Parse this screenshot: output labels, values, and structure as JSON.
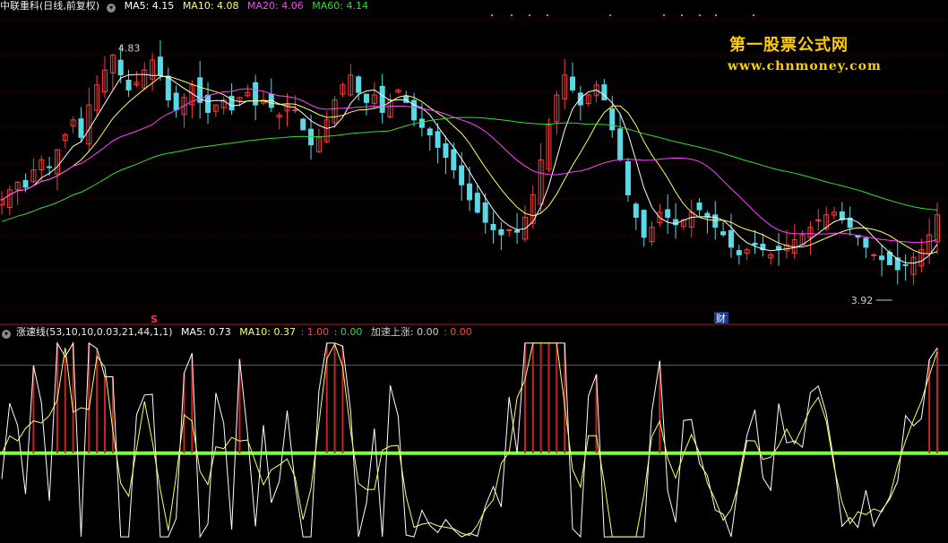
{
  "main_header": {
    "title": "中联重科(日线,前复权)",
    "ma5": "MA5: 4.15",
    "ma10": "MA10: 4.08",
    "ma20": "MA20: 4.06",
    "ma60": "MA60: 4.14"
  },
  "sub_header": {
    "title": "涨速线(53,10,10,0.03,21,44,1,1)",
    "ma5": "MA5: 0.73",
    "ma10": "MA10: 0.37",
    "v1": ": 1.00",
    "v2": ": 0.00",
    "accel_label": "加速上涨: 0.00",
    "v3": ": 0.00"
  },
  "watermark": {
    "line1": "第一股票公式网",
    "line2": "www.chnmoney.com"
  },
  "markers": {
    "s_label": "S",
    "fin_label": "财"
  },
  "colors": {
    "up": "#ff3b3b",
    "down": "#5ad8e6",
    "ma5": "#ffffff",
    "ma10": "#ffff66",
    "ma20": "#ff44ff",
    "ma60": "#33dd33",
    "green_band": "#7cff3c",
    "red_line": "#e02020"
  },
  "chart_data": [
    {
      "type": "candlestick",
      "title": "中联重科(日线,前复权)",
      "annotations": [
        {
          "label": "4.83",
          "type": "high"
        },
        {
          "label": "3.92",
          "type": "low"
        }
      ],
      "series": [
        {
          "name": "MA5",
          "value": 4.15
        },
        {
          "name": "MA10",
          "value": 4.08
        },
        {
          "name": "MA20",
          "value": 4.06
        },
        {
          "name": "MA60",
          "value": 4.14
        }
      ],
      "close": [
        4.2,
        4.24,
        4.27,
        4.25,
        4.32,
        4.36,
        4.33,
        4.4,
        4.46,
        4.52,
        4.45,
        4.58,
        4.66,
        4.72,
        4.78,
        4.7,
        4.64,
        4.67,
        4.72,
        4.76,
        4.7,
        4.6,
        4.56,
        4.61,
        4.66,
        4.59,
        4.55,
        4.58,
        4.6,
        4.56,
        4.61,
        4.63,
        4.58,
        4.6,
        4.57,
        4.54,
        4.58,
        4.56,
        4.48,
        4.42,
        4.45,
        4.52,
        4.6,
        4.66,
        4.7,
        4.63,
        4.59,
        4.62,
        4.55,
        4.6,
        4.64,
        4.59,
        4.52,
        4.49,
        4.46,
        4.41,
        4.37,
        4.32,
        4.26,
        4.2,
        4.15,
        4.11,
        4.08,
        4.06,
        4.08,
        4.07,
        4.13,
        4.22,
        4.36,
        4.5,
        4.62,
        4.7,
        4.64,
        4.58,
        4.62,
        4.66,
        4.6,
        4.48,
        4.36,
        4.22,
        4.13,
        4.05,
        4.09,
        4.15,
        4.13,
        4.1,
        4.12,
        4.15,
        4.16,
        4.13,
        4.09,
        4.06,
        4.01,
        3.98,
        4.0,
        4.02,
        4.0,
        3.98,
        4.0,
        4.02,
        4.04,
        4.06,
        4.09,
        4.12,
        4.14,
        4.15,
        4.12,
        4.09,
        4.05,
        4.01,
        3.98,
        3.96,
        3.94,
        3.92,
        3.94,
        3.97,
        4.0,
        4.06,
        4.14
      ],
      "ylim": [
        3.78,
        4.95
      ]
    },
    {
      "type": "line",
      "title": "涨速线(53,10,10,0.03,21,44,1,1)",
      "series": [
        {
          "name": "MA5",
          "value": 0.73
        },
        {
          "name": "MA10",
          "value": 0.37
        }
      ],
      "reference_lines": [
        1.0,
        0.0
      ],
      "accel_label": "加速上涨",
      "accel_value": 0.0,
      "ylim": [
        -1.0,
        1.3
      ]
    }
  ]
}
